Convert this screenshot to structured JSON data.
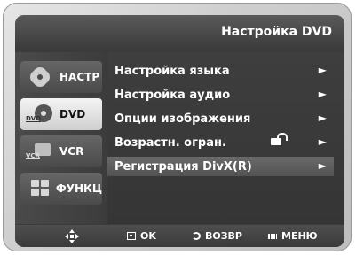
{
  "header": {
    "title": "Настройка DVD"
  },
  "sidebar": {
    "items": [
      {
        "label": "НАСТР",
        "icon": "gear-icon",
        "active": false
      },
      {
        "label": "DVD",
        "icon": "disc-icon",
        "badge": "DVD",
        "active": true
      },
      {
        "label": "VCR",
        "icon": "tape-icon",
        "badge": "VCR",
        "active": false
      },
      {
        "label": "ФУНКЦ",
        "icon": "grid-icon",
        "active": false
      }
    ]
  },
  "menu": {
    "items": [
      {
        "label": "Настройка языка",
        "arrow": "►",
        "selected": false
      },
      {
        "label": "Настройка аудио",
        "arrow": "►",
        "selected": false
      },
      {
        "label": "Опции изображения",
        "arrow": "►",
        "selected": false
      },
      {
        "label": "Возрастн. огран.",
        "arrow": "►",
        "selected": false,
        "icon": "unlock-icon"
      },
      {
        "label": "Регистрация DivX(R)",
        "arrow": "►",
        "selected": true
      }
    ]
  },
  "footer": {
    "nav_icon": "dpad-icon",
    "ok_label": "OK",
    "back_label": "ВОЗВР",
    "menu_label": "МЕНЮ"
  },
  "colors": {
    "background": "#3b3b3b",
    "highlight": "#5e5e5e",
    "text": "#ffffff"
  }
}
